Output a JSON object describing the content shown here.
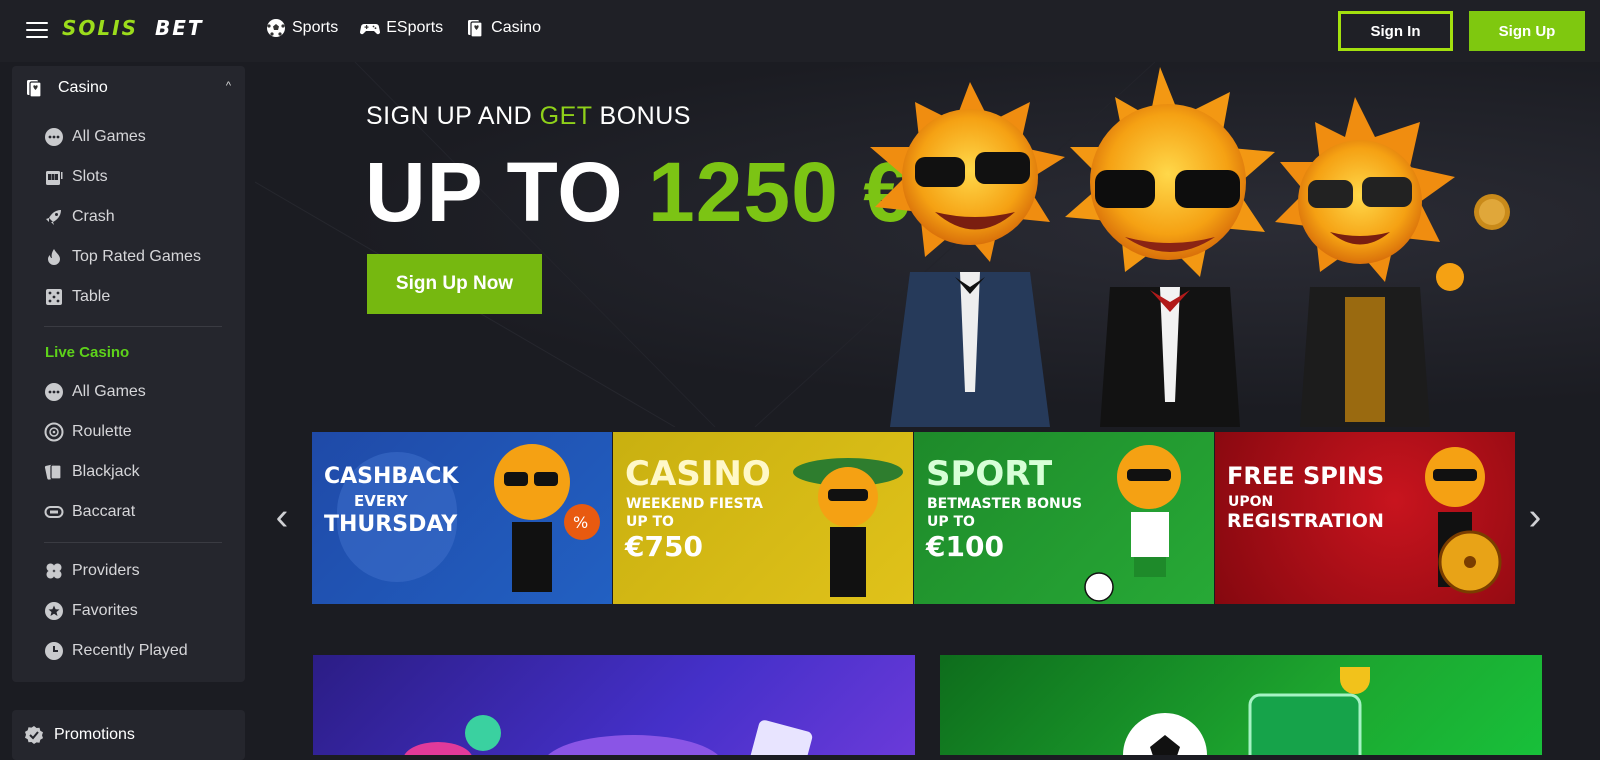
{
  "header": {
    "logo_part1": "SOLIS",
    "logo_part2": "BET",
    "nav": [
      {
        "label": "Sports",
        "icon": "soccer-ball-icon"
      },
      {
        "label": "ESports",
        "icon": "gamepad-icon"
      },
      {
        "label": "Casino",
        "icon": "cards-icon"
      }
    ],
    "signin_label": "Sign In",
    "signup_label": "Sign Up"
  },
  "sidebar": {
    "section_title": "Casino",
    "casino_items": [
      {
        "label": "All Games",
        "icon": "dots-icon"
      },
      {
        "label": "Slots",
        "icon": "slot-machine-icon"
      },
      {
        "label": "Crash",
        "icon": "rocket-icon"
      },
      {
        "label": "Top Rated Games",
        "icon": "flame-icon"
      },
      {
        "label": "Table",
        "icon": "dice-icon"
      }
    ],
    "live_title": "Live Casino",
    "live_items": [
      {
        "label": "All Games",
        "icon": "dots-icon"
      },
      {
        "label": "Roulette",
        "icon": "roulette-icon"
      },
      {
        "label": "Blackjack",
        "icon": "cards-icon"
      },
      {
        "label": "Baccarat",
        "icon": "baccarat-icon"
      }
    ],
    "extra_items": [
      {
        "label": "Providers",
        "icon": "clover-icon"
      },
      {
        "label": "Favorites",
        "icon": "star-icon"
      },
      {
        "label": "Recently Played",
        "icon": "clock-icon"
      }
    ],
    "promotions_label": "Promotions"
  },
  "hero": {
    "sub_a": "SIGN UP AND ",
    "sub_g": "GET",
    "sub_b": " BONUS",
    "title_a": "UP TO ",
    "title_g": "1250 €",
    "button_label": "Sign Up Now"
  },
  "promos": [
    {
      "big1": "CASHBACK",
      "mid": "EVERY",
      "big2": "THURSDAY",
      "color": "#1f4aa8"
    },
    {
      "big1": "CASINO",
      "small1": "WEEKEND FIESTA",
      "small2": "UP TO",
      "big2": "€750",
      "color": "#c9b010"
    },
    {
      "big1": "SPORT",
      "small1": "BETMASTER BONUS",
      "small2": "UP TO",
      "big2": "€100",
      "color": "#1e8a2a"
    },
    {
      "big1": "FREE SPINS",
      "small1": "UPON",
      "big2": "REGISTRATION",
      "color": "#a4101a"
    }
  ],
  "colors": {
    "accent": "#8fd11a",
    "background": "#1b1c22",
    "sidebar": "#25262d"
  }
}
